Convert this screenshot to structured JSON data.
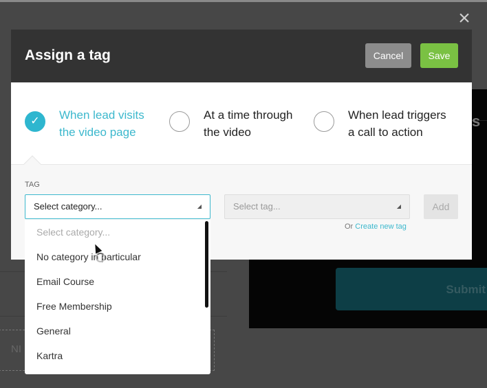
{
  "modal": {
    "title": "Assign a tag",
    "cancel_label": "Cancel",
    "save_label": "Save",
    "options": [
      {
        "label_line1": "When lead visits",
        "label_line2": "the video page",
        "selected": true
      },
      {
        "label_line1": "At a time through",
        "label_line2": "the video",
        "selected": false
      },
      {
        "label_line1": "When lead triggers",
        "label_line2": "a call to action",
        "selected": false
      }
    ],
    "tag_label": "TAG",
    "category_select": {
      "value": "Select category..."
    },
    "tag_select": {
      "placeholder": "Select tag..."
    },
    "add_label": "Add",
    "or_text": "Or",
    "create_new_tag": "Create new tag",
    "dropdown_items": [
      "Select category...",
      "No category in particular",
      "Email Course",
      "Free Membership",
      "General",
      "Kartra"
    ]
  },
  "background": {
    "submit_label": "Submit",
    "partial_text": "NI",
    "partial_heading": "s"
  },
  "colors": {
    "accent": "#3cb8cd",
    "save": "#7ac143",
    "cancel": "#8c8c8c",
    "header": "#333333"
  }
}
